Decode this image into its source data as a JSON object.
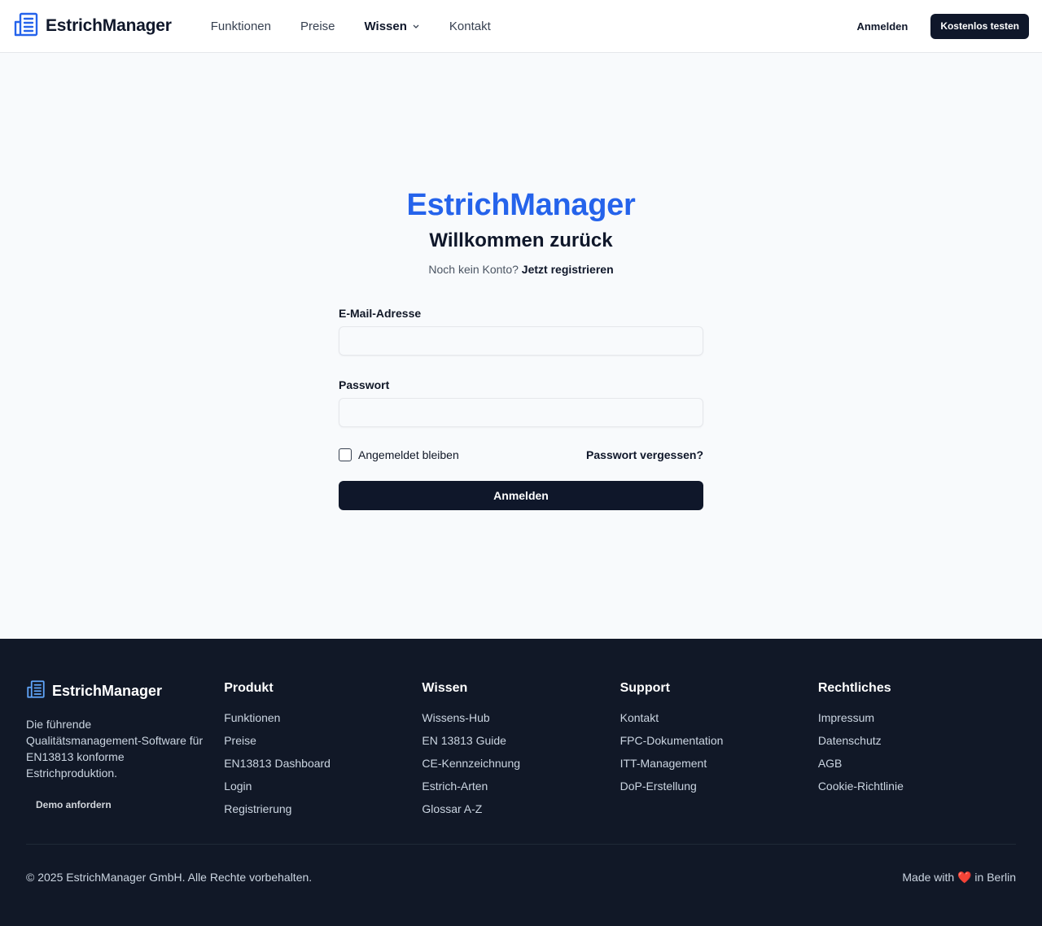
{
  "header": {
    "logo_text": "EstrichManager",
    "nav": [
      {
        "label": "Funktionen"
      },
      {
        "label": "Preise"
      },
      {
        "label": "Wissen"
      },
      {
        "label": "Kontakt"
      }
    ],
    "login_label": "Anmelden",
    "cta_label": "Kostenlos testen"
  },
  "main": {
    "brand_title": "EstrichManager",
    "welcome": "Willkommen zurück",
    "no_account_text": "Noch kein Konto?",
    "register_link": "Jetzt registrieren",
    "email_label": "E-Mail-Adresse",
    "email_value": "",
    "password_label": "Passwort",
    "password_value": "",
    "remember_label": "Angemeldet bleiben",
    "forgot_label": "Passwort vergessen?",
    "submit_label": "Anmelden"
  },
  "footer": {
    "logo_text": "EstrichManager",
    "description": "Die führende Qualitätsmanagement-Software für EN13813 konforme Estrichproduktion.",
    "demo_label": "Demo anfordern",
    "columns": [
      {
        "title": "Produkt",
        "links": [
          "Funktionen",
          "Preise",
          "EN13813 Dashboard",
          "Login",
          "Registrierung"
        ]
      },
      {
        "title": "Wissen",
        "links": [
          "Wissens-Hub",
          "EN 13813 Guide",
          "CE-Kennzeichnung",
          "Estrich-Arten",
          "Glossar A-Z"
        ]
      },
      {
        "title": "Support",
        "links": [
          "Kontakt",
          "FPC-Dokumentation",
          "ITT-Management",
          "DoP-Erstellung"
        ]
      },
      {
        "title": "Rechtliches",
        "links": [
          "Impressum",
          "Datenschutz",
          "AGB",
          "Cookie-Richtlinie"
        ]
      }
    ],
    "copyright": "© 2025 EstrichManager GmbH. Alle Rechte vorbehalten.",
    "made_with_prefix": "Made with",
    "heart": "❤️",
    "made_with_suffix": "in Berlin"
  },
  "colors": {
    "brand_blue": "#2563eb",
    "dark": "#0f172a",
    "footer_bg": "#111827"
  }
}
